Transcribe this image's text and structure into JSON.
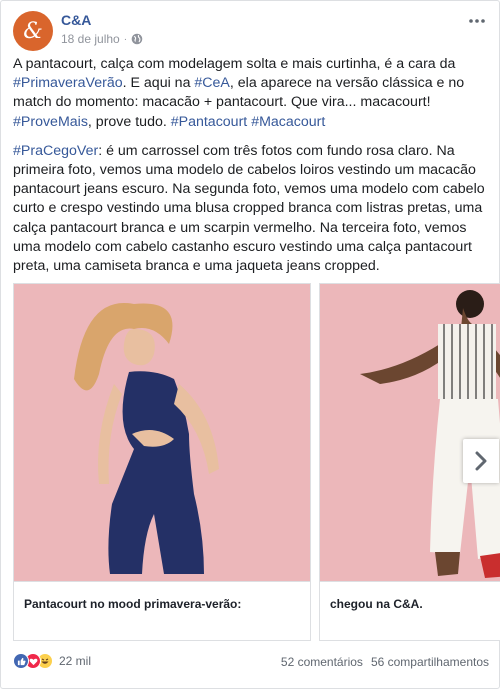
{
  "post": {
    "page_name": "C&A",
    "date": "18 de julho",
    "text": {
      "p1": [
        {
          "t": "A pantacourt, calça com modelagem solta e mais curtinha, é a cara da ",
          "tag": false
        },
        {
          "t": "#PrimaveraVerão",
          "tag": true
        },
        {
          "t": ". E aqui na ",
          "tag": false
        },
        {
          "t": "#CeA",
          "tag": true
        },
        {
          "t": ", ela aparece na versão clássica e no match do momento: macacão + pantacourt. Que vira... macacourt! ",
          "tag": false
        },
        {
          "t": "#ProveMais",
          "tag": true
        },
        {
          "t": ", prove tudo. ",
          "tag": false
        },
        {
          "t": "#Pantacourt",
          "tag": true
        },
        {
          "t": " ",
          "tag": false
        },
        {
          "t": "#Macacourt",
          "tag": true
        }
      ],
      "p2": [
        {
          "t": "#PraCegoVer",
          "tag": true
        },
        {
          "t": ": é um carrossel com três fotos com fundo rosa claro. Na primeira foto, vemos uma modelo de cabelos loiros vestindo um macacão pantacourt jeans escuro. Na segunda foto, vemos uma modelo com cabelo curto e crespo vestindo uma blusa cropped branca com listras pretas, uma calça pantacourt branca e um scarpin vermelho. Na terceira foto, vemos uma modelo com cabelo castanho escuro vestindo uma calça pantacourt preta, uma camiseta branca e uma jaqueta jeans cropped.",
          "tag": false
        }
      ]
    },
    "carousel": [
      {
        "caption": "Pantacourt no mood primavera-verão:"
      },
      {
        "caption": "chegou na C&A."
      }
    ],
    "reactions": {
      "count": "22 mil"
    },
    "comments": "52 comentários",
    "shares": "56 compartilhamentos"
  },
  "icons": [
    "ca-logo-icon",
    "globe-icon",
    "more-options-icon",
    "chevron-right-icon",
    "like-reaction-icon",
    "love-reaction-icon",
    "haha-reaction-icon"
  ],
  "colors": {
    "link": "#365899",
    "brand": "#d9652c",
    "photo_bg": "#ebb4b7",
    "meta": "#90949c"
  }
}
